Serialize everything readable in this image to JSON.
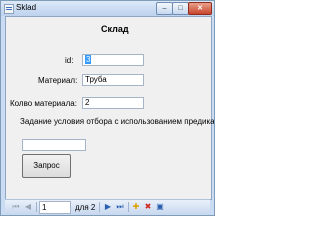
{
  "window": {
    "title": "Sklad",
    "controls": {
      "minimize": "–",
      "maximize": "□",
      "close": "✕"
    }
  },
  "form": {
    "heading": "Склад",
    "id_label": "id:",
    "id_value": "3",
    "material_label": "Материал:",
    "material_value": "Труба",
    "qty_label": "Колво  материала:",
    "qty_value": "2",
    "hint": "Задание условия отбора с использованием предиката LIKE",
    "extra_value": "",
    "query_button": "Запрос"
  },
  "navigator": {
    "position": "1",
    "count_label": "для 2",
    "icons": {
      "first": "⏮",
      "prev": "◀",
      "next": "▶",
      "last": "⏭",
      "add": "✚",
      "delete": "✖",
      "save": "▣"
    },
    "colors": {
      "add": "#e0a000",
      "delete": "#d0281c",
      "save": "#2a5fb0"
    }
  }
}
